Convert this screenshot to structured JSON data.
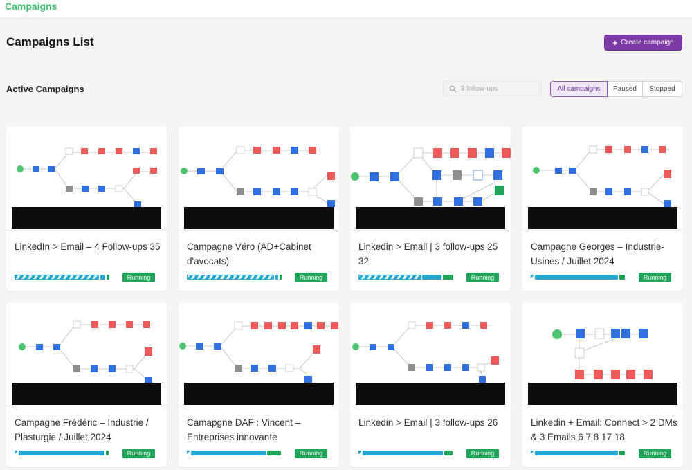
{
  "app": {
    "brand": "Campaigns"
  },
  "header": {
    "page_title": "Campaigns List",
    "create_label": "Create campaign",
    "create_icon": "plus-icon"
  },
  "section": {
    "title": "Active Campaigns"
  },
  "search": {
    "placeholder": "3 follow-ups",
    "icon": "search-icon"
  },
  "filters": [
    {
      "label": "All campaigns",
      "active": true
    },
    {
      "label": "Paused",
      "active": false
    },
    {
      "label": "Stopped",
      "active": false
    }
  ],
  "colors": {
    "brand": "#3fbf6f",
    "accent": "#7b3aa6",
    "running": "#22a55b",
    "progress": "#29a7d0"
  },
  "campaigns": [
    {
      "name": "LinkedIn > Email – 4 Follow-ups 35",
      "status": "Running",
      "progress_style": "striped"
    },
    {
      "name": "Campagne Véro (AD+Cabinet d'avocats)",
      "status": "Running",
      "progress_style": "striped"
    },
    {
      "name": "Linkedin > Email | 3 follow-ups 25 32",
      "status": "Running",
      "progress_style": "striped-partial"
    },
    {
      "name": "Campagne Georges – Industrie-Usines / Juillet 2024",
      "status": "Running",
      "progress_style": "solid"
    },
    {
      "name": "Campagne Frédéric – Industrie / Plasturgie / Juillet 2024",
      "status": "Running",
      "progress_style": "solid"
    },
    {
      "name": "Camapgne DAF : Vincent – Entreprises innovante",
      "status": "Running",
      "progress_style": "solid"
    },
    {
      "name": "Linkedin > Email | 3 follow-ups 26",
      "status": "Running",
      "progress_style": "solid"
    },
    {
      "name": "Linkedin + Email: Connect > 2 DMs & 3 Emails 6 7 8 17 18",
      "status": "Running",
      "progress_style": "solid"
    }
  ]
}
